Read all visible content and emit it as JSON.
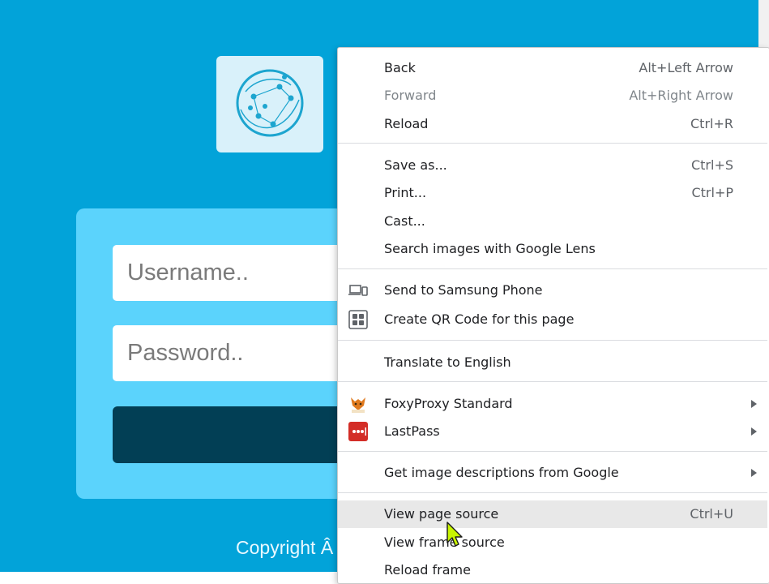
{
  "page": {
    "username_placeholder": "Username..",
    "password_placeholder": "Password..",
    "copyright": "Copyright Â",
    "colors": {
      "background": "#02a3d9",
      "card": "#5bd3fc",
      "button": "#023f55"
    }
  },
  "context_menu": {
    "back": {
      "label": "Back",
      "shortcut": "Alt+Left Arrow"
    },
    "forward": {
      "label": "Forward",
      "shortcut": "Alt+Right Arrow"
    },
    "reload": {
      "label": "Reload",
      "shortcut": "Ctrl+R"
    },
    "save_as": {
      "label": "Save as...",
      "shortcut": "Ctrl+S"
    },
    "print": {
      "label": "Print...",
      "shortcut": "Ctrl+P"
    },
    "cast": {
      "label": "Cast..."
    },
    "google_lens": {
      "label": "Search images with Google Lens"
    },
    "send_to_phone": {
      "label": "Send to Samsung Phone",
      "icon": "devices-icon"
    },
    "qr_code": {
      "label": "Create QR Code for this page",
      "icon": "qr-code-icon"
    },
    "translate": {
      "label": "Translate to English"
    },
    "foxyproxy": {
      "label": "FoxyProxy Standard",
      "icon": "foxyproxy-icon"
    },
    "lastpass": {
      "label": "LastPass",
      "icon": "lastpass-icon"
    },
    "image_descriptions": {
      "label": "Get image descriptions from Google"
    },
    "view_source": {
      "label": "View page source",
      "shortcut": "Ctrl+U"
    },
    "view_frame_source": {
      "label": "View frame source"
    },
    "reload_frame": {
      "label": "Reload frame"
    }
  }
}
